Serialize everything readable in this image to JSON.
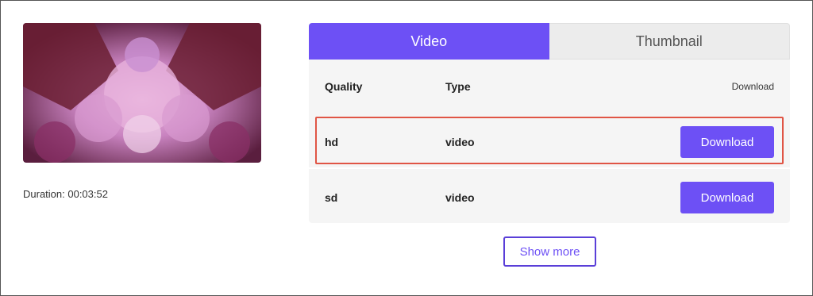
{
  "media": {
    "thumbnail_alt": "flower kaleidoscope thumbnail",
    "duration_text": "Duration: 00:03:52"
  },
  "tabs": [
    {
      "label": "Video",
      "active": true
    },
    {
      "label": "Thumbnail",
      "active": false
    }
  ],
  "table": {
    "headers": {
      "quality": "Quality",
      "type": "Type",
      "download": "Download"
    },
    "rows": [
      {
        "quality": "hd",
        "type": "video",
        "action": "Download",
        "highlighted": true
      },
      {
        "quality": "sd",
        "type": "video",
        "action": "Download",
        "highlighted": false
      }
    ]
  },
  "show_more_label": "Show more",
  "colors": {
    "accent": "#6d50f5",
    "highlight_border": "#e05545",
    "panel_bg": "#f5f5f5"
  }
}
